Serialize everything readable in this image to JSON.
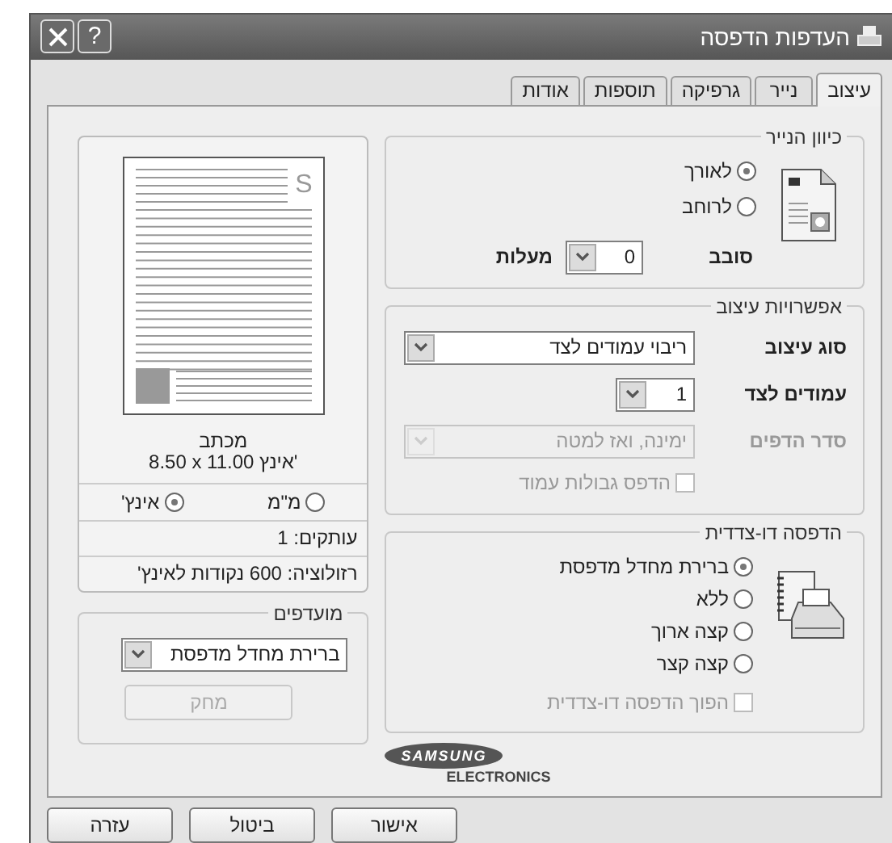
{
  "window": {
    "title": "העדפות הדפסה",
    "help": "?"
  },
  "tabs": [
    {
      "label": "עיצוב",
      "selected": true
    },
    {
      "label": "נייר",
      "selected": false
    },
    {
      "label": "גרפיקה",
      "selected": false
    },
    {
      "label": "תוספות",
      "selected": false
    },
    {
      "label": "אודות",
      "selected": false
    }
  ],
  "orientation": {
    "title": "כיוון הנייר",
    "options": [
      {
        "label": "לאורך",
        "selected": true
      },
      {
        "label": "לרוחב",
        "selected": false
      }
    ],
    "rotate_label": "סובב",
    "rotate_value": "0",
    "rotate_unit": "מעלות"
  },
  "layout_options": {
    "title": "אפשרויות עיצוב",
    "rows": [
      {
        "label": "סוג עיצוב",
        "value": "ריבוי עמודים לצד",
        "kind": "wide",
        "disabled": false
      },
      {
        "label": "עמודים לצד",
        "value": "1",
        "kind": "narrow",
        "disabled": false
      },
      {
        "label": "סדר הדפים",
        "value": "ימינה, ואז למטה",
        "kind": "wide",
        "disabled": true
      }
    ],
    "border_checkbox": {
      "label": "הדפס גבולות עמוד",
      "checked": false,
      "disabled": true
    }
  },
  "duplex": {
    "title": "הדפסה דו-צדדית",
    "options": [
      {
        "label": "ברירת מחדל מדפסת",
        "selected": true
      },
      {
        "label": "ללא",
        "selected": false
      },
      {
        "label": "קצה ארוך",
        "selected": false
      },
      {
        "label": "קצה קצר",
        "selected": false
      }
    ],
    "reverse_checkbox": {
      "label": "הפוך הדפסה דו-צדדית",
      "checked": false,
      "disabled": true
    }
  },
  "logo": {
    "brand": "SAMSUNG",
    "sub": "ELECTRONICS"
  },
  "preview": {
    "mark": "S",
    "paper_name": "מכתב",
    "paper_size": "8.50 x 11.00 אינץ'",
    "units": [
      {
        "label": "מ\"מ",
        "selected": false
      },
      {
        "label": "אינץ'",
        "selected": true
      }
    ],
    "copies": "עותקים: 1",
    "resolution": "רזולוציה: 600 נקודות לאינץ'"
  },
  "favorites": {
    "title": "מועדפים",
    "value": "ברירת מחדל מדפסת",
    "delete_button": {
      "label": "מחק",
      "disabled": true
    }
  },
  "buttons": [
    "אישור",
    "ביטול",
    "עזרה"
  ]
}
